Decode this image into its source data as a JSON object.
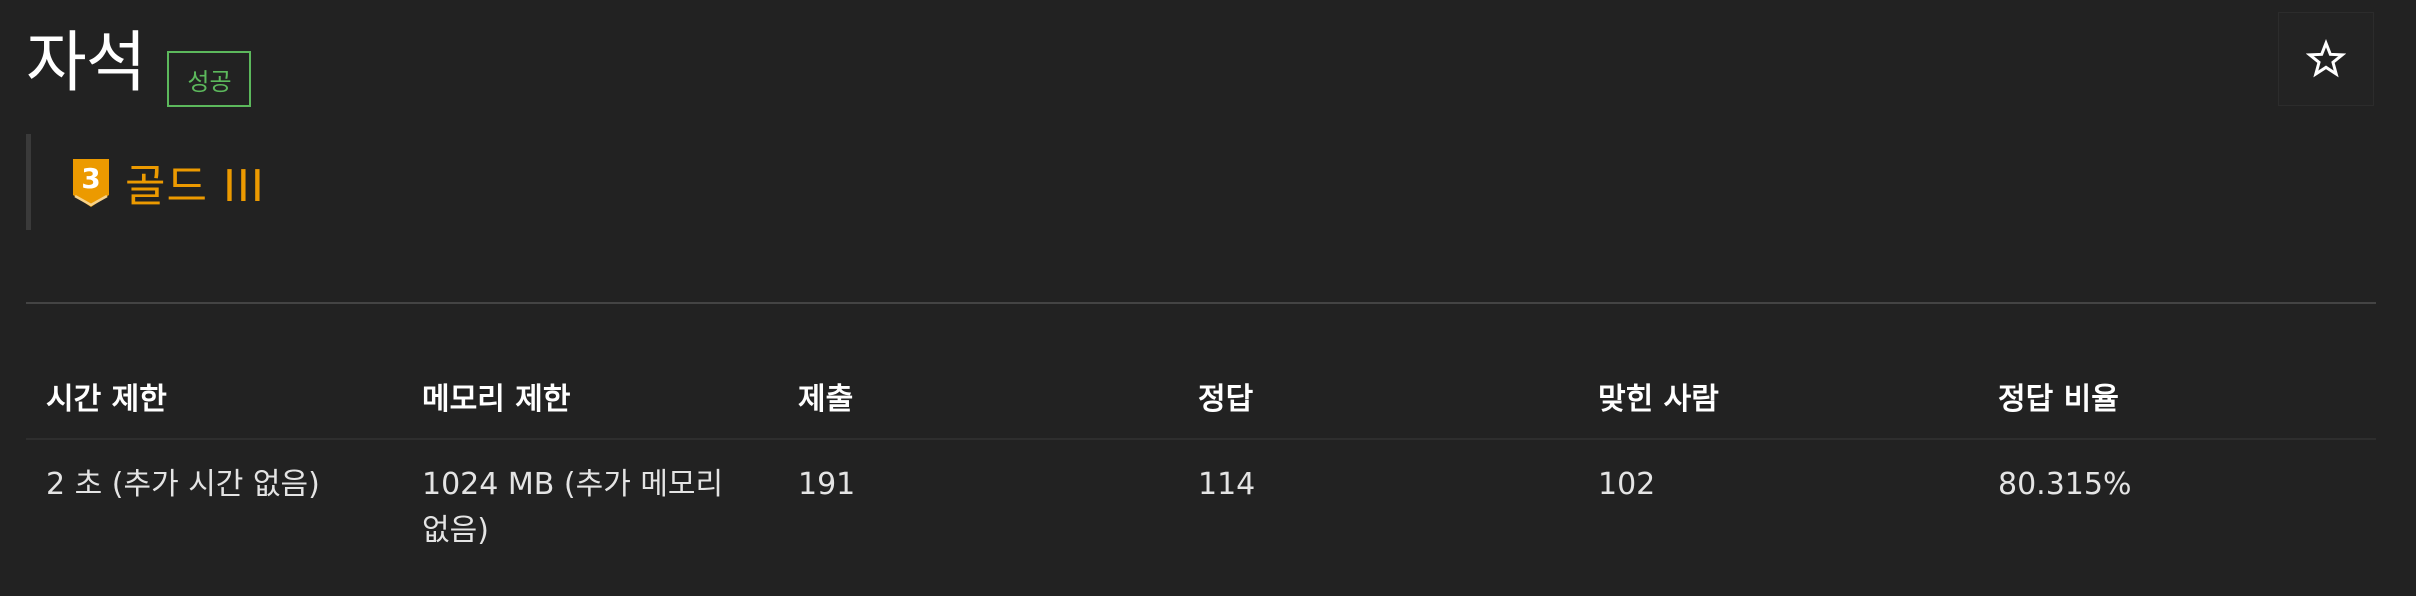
{
  "problem": {
    "title": "자석",
    "status_badge": "성공",
    "tier": {
      "label": "골드 III",
      "level_number": "3",
      "color": "#ec9a00"
    },
    "star_icon": "star-outline-icon"
  },
  "info_table": {
    "headers": [
      "시간 제한",
      "메모리 제한",
      "제출",
      "정답",
      "맞힌 사람",
      "정답 비율"
    ],
    "row": [
      "2 초 (추가 시간 없음)",
      "1024 MB (추가 메모리 없음)",
      "191",
      "114",
      "102",
      "80.315%"
    ]
  },
  "colors": {
    "background": "#222222",
    "success": "#5cb85c",
    "gold": "#ec9a00"
  }
}
